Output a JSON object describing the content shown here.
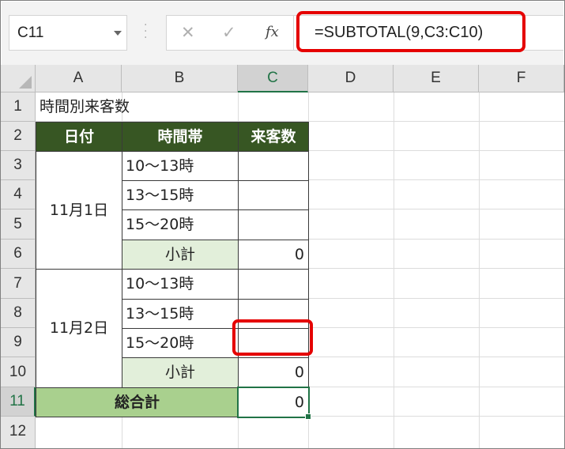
{
  "name_box": {
    "value": "C11"
  },
  "formula_bar": {
    "cancel_icon": "close-icon",
    "enter_icon": "check-icon",
    "fx_label": "fx",
    "formula": "=SUBTOTAL(9,C3:C10)"
  },
  "columns": [
    "A",
    "B",
    "C",
    "D",
    "E",
    "F"
  ],
  "rows": [
    "1",
    "2",
    "3",
    "4",
    "5",
    "6",
    "7",
    "8",
    "9",
    "10",
    "11",
    "12"
  ],
  "selected": {
    "column": "C",
    "row": "11"
  },
  "sheet": {
    "title": "時間別来客数",
    "headers": {
      "date": "日付",
      "time_slot": "時間帯",
      "visitors": "来客数"
    },
    "group1": {
      "date": "11月1日",
      "slots": [
        "10～13時",
        "13～15時",
        "15～20時"
      ],
      "subtotal_label": "小計",
      "subtotal_value": "0"
    },
    "group2": {
      "date": "11月2日",
      "slots": [
        "10～13時",
        "13～15時",
        "15～20時"
      ],
      "subtotal_label": "小計",
      "subtotal_value": "0"
    },
    "grand_total_label": "総合計",
    "grand_total_value": "0"
  },
  "colors": {
    "header_fill": "#375623",
    "subtotal_fill": "#e2efda",
    "total_fill": "#a9d08e",
    "highlight": "#e50000",
    "selection": "#217346"
  }
}
